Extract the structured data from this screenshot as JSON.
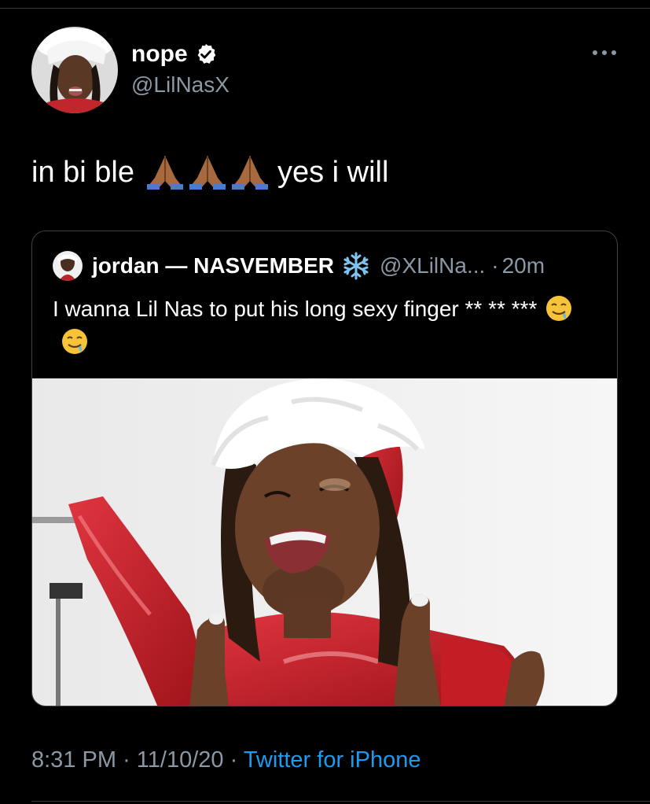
{
  "author": {
    "display_name": "nope",
    "handle": "@LilNasX",
    "verified": true
  },
  "tweet": {
    "text_before": "in bi ble",
    "emoji": [
      "folded-hands-icon",
      "folded-hands-icon",
      "folded-hands-icon"
    ],
    "text_after": "yes i will"
  },
  "quoted_tweet": {
    "display_name": "jordan — NASVEMBER",
    "name_emoji": "snowflake-icon",
    "handle": "@XLilNa...",
    "separator": "·",
    "time": "20m",
    "text": "I wanna Lil Nas to put his long sexy finger ** ** ***",
    "text_emoji": [
      "drooling-face-icon",
      "drooling-face-icon"
    ],
    "media": "photo-person-santa-hat"
  },
  "meta": {
    "time": "8:31 PM",
    "sep1": "·",
    "date": "11/10/20",
    "sep2": "·",
    "source": "Twitter for iPhone"
  },
  "colors": {
    "background": "#000000",
    "secondary_text": "#8b98a5",
    "link": "#1d9bf0",
    "border": "#3d4248"
  }
}
